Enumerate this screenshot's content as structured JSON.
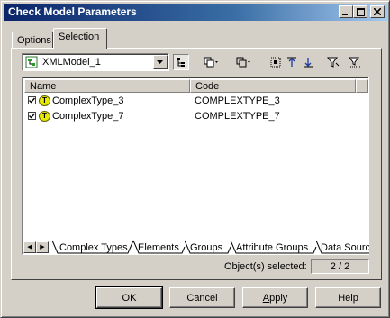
{
  "window": {
    "title": "Check Model Parameters"
  },
  "tabs": [
    "Options",
    "Selection"
  ],
  "model_select": {
    "value": "XMLModel_1"
  },
  "list": {
    "columns": [
      "Name",
      "Code"
    ],
    "rows": [
      {
        "checked": true,
        "name": "ComplexType_3",
        "code": "COMPLEXTYPE_3"
      },
      {
        "checked": true,
        "name": "ComplexType_7",
        "code": "COMPLEXTYPE_7"
      }
    ]
  },
  "category_tabs": [
    "Complex Types",
    "Elements",
    "Groups",
    "Attribute Groups",
    "Data Sourc"
  ],
  "selection": {
    "label": "Object(s) selected:",
    "count": "2 / 2"
  },
  "buttons": {
    "ok": "OK",
    "cancel": "Cancel",
    "apply_prefix": "",
    "apply_ul": "A",
    "apply_rest": "pply",
    "help": "Help"
  },
  "icons": {
    "minimize": "minimize-icon",
    "maximize": "maximize-icon",
    "close": "close-icon",
    "model": "model-icon",
    "dropdown": "chevron-down-icon",
    "include_submodels": "tree-icon",
    "select_all": "select-all-icon",
    "deselect_all": "deselect-all-icon",
    "move_top": "move-top-icon",
    "move_bottom": "move-bottom-icon",
    "filter": "filter-icon",
    "filter_clear": "filter-clear-icon"
  },
  "colors": {
    "titlebar": "#0a246a",
    "face": "#d4d0c8"
  }
}
